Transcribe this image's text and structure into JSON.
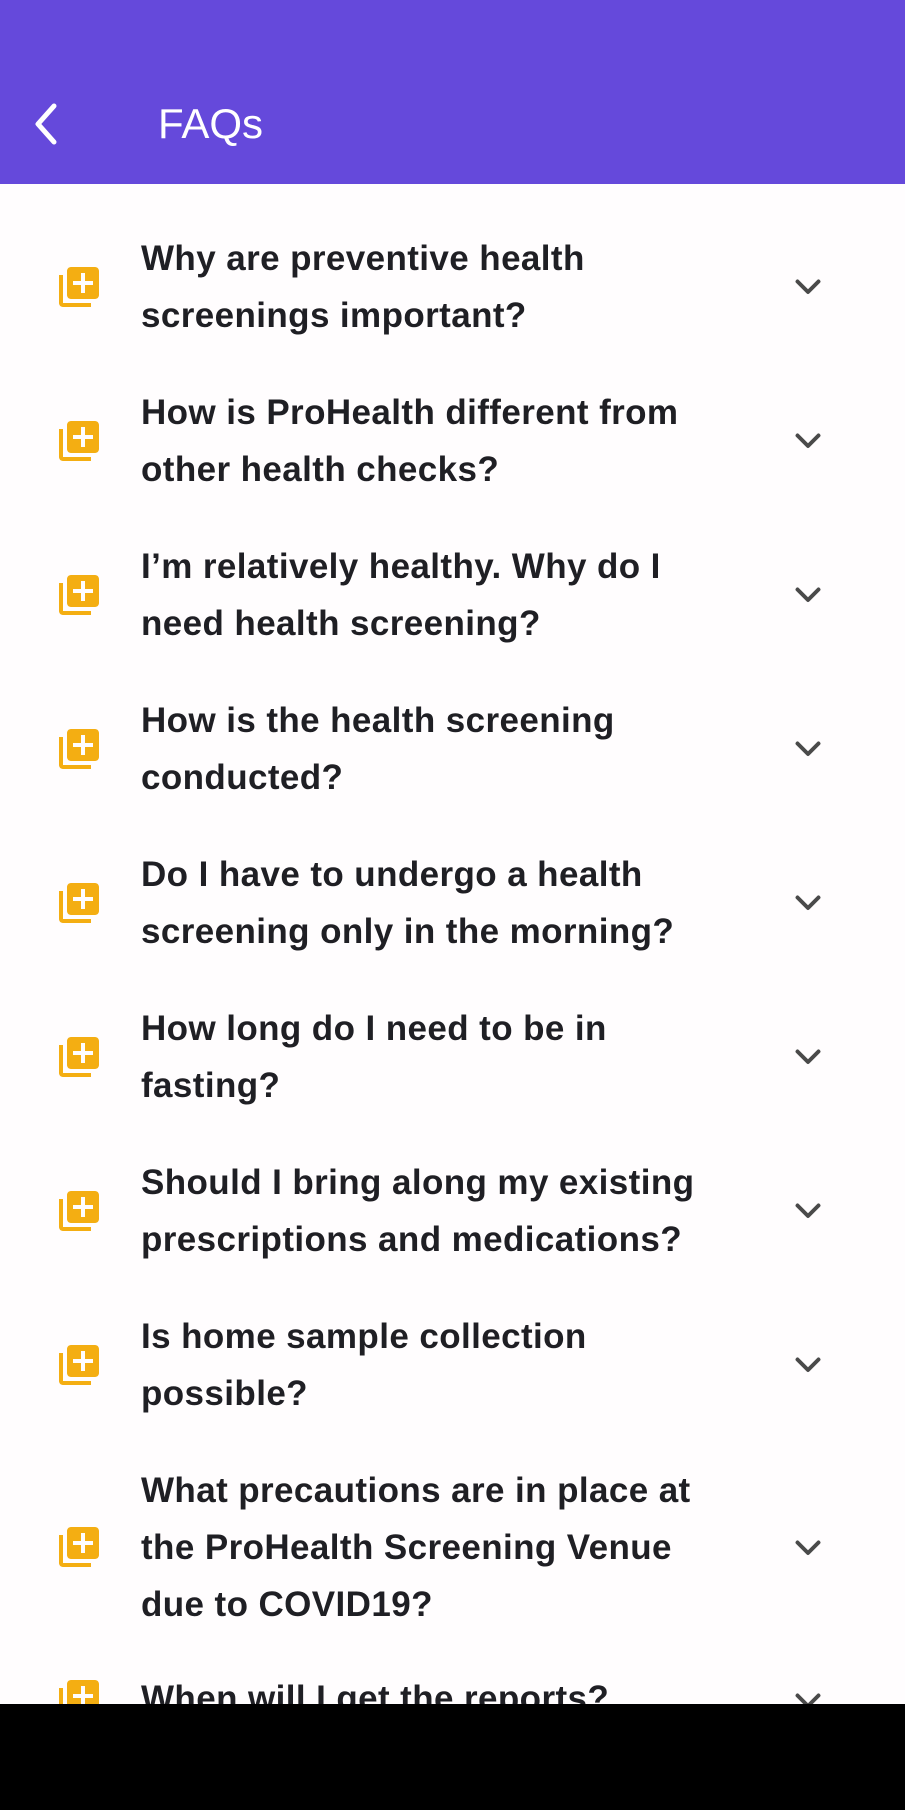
{
  "header": {
    "title": "FAQs",
    "back_icon": "chevron-left-icon"
  },
  "colors": {
    "app_bar": "#6549db",
    "icon_accent": "#f4ae12",
    "question_text": "#1f1f24",
    "chevron": "#4a4a4a",
    "background": "#fffdfe"
  },
  "faq": {
    "item_icon": "library-add-icon",
    "expand_icon": "chevron-down-icon",
    "items": [
      {
        "question": "Why are preventive health screenings important?"
      },
      {
        "question": "How is ProHealth different from other health checks?"
      },
      {
        "question": "I’m relatively healthy. Why do I need health screening?"
      },
      {
        "question": "How is the health screening conducted?"
      },
      {
        "question": "Do I have to undergo a health screening only in the morning?"
      },
      {
        "question": "How long do I need to be in fasting?"
      },
      {
        "question": "Should I bring along my existing prescriptions and medications?"
      },
      {
        "question": "Is home sample collection possible?"
      },
      {
        "question": "What precautions are in place at the ProHealth Screening Venue due to COVID19?"
      },
      {
        "question": "When will I get the reports?"
      }
    ]
  }
}
